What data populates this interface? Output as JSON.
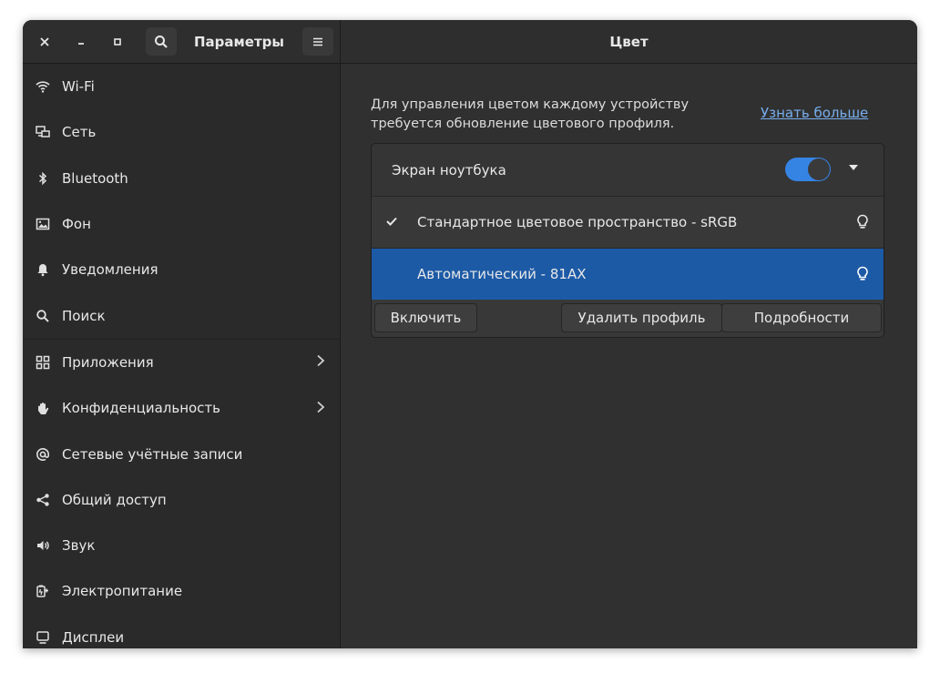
{
  "sidebar": {
    "title": "Параметры",
    "items": [
      {
        "label": "Wi-Fi",
        "icon": "wifi-icon"
      },
      {
        "label": "Сеть",
        "icon": "network-icon"
      },
      {
        "label": "Bluetooth",
        "icon": "bluetooth-icon"
      },
      {
        "label": "Фон",
        "icon": "background-icon"
      },
      {
        "label": "Уведомления",
        "icon": "bell-icon"
      },
      {
        "label": "Поиск",
        "icon": "search-icon"
      },
      {
        "label": "Приложения",
        "icon": "apps-icon",
        "chevron": true
      },
      {
        "label": "Конфиденциальность",
        "icon": "hand-icon",
        "chevron": true
      },
      {
        "label": "Сетевые учётные записи",
        "icon": "at-icon"
      },
      {
        "label": "Общий доступ",
        "icon": "share-icon"
      },
      {
        "label": "Звук",
        "icon": "speaker-icon"
      },
      {
        "label": "Электропитание",
        "icon": "power-icon"
      },
      {
        "label": "Дисплеи",
        "icon": "display-icon"
      }
    ]
  },
  "main": {
    "title": "Цвет",
    "description": "Для управления цветом каждому устройству требуется обновление цветового профиля.",
    "learn_more": "Узнать больше",
    "device": {
      "label": "Экран ноутбука",
      "enabled": true
    },
    "profiles": [
      {
        "label": "Стандартное цветовое пространство - sRGB",
        "checked": true,
        "selected": false
      },
      {
        "label": "Автоматический - 81AX",
        "checked": false,
        "selected": true
      }
    ],
    "buttons": {
      "enable": "Включить",
      "remove": "Удалить профиль",
      "details": "Подробности"
    }
  },
  "colors": {
    "accent": "#3584e4",
    "selected_row": "#1c5aa6",
    "link": "#78aeed"
  }
}
